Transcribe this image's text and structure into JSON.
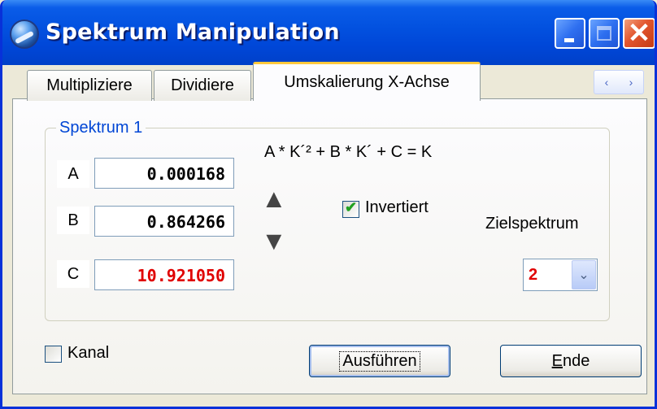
{
  "window": {
    "title": "Spektrum Manipulation",
    "icon": "spectrum-app-icon",
    "controls": {
      "minimize_icon": "minimize-icon",
      "maximize_icon": "maximize-icon",
      "close_symbol": "✕"
    }
  },
  "tabs": [
    {
      "label": "Multipliziere",
      "active": false
    },
    {
      "label": "Dividiere",
      "active": false
    },
    {
      "label": "Umskalierung X-Achse",
      "active": true
    }
  ],
  "tab_scroll": {
    "left": "‹",
    "right": "›"
  },
  "group": {
    "label": "Spektrum 1",
    "params": [
      {
        "label": "A",
        "value": "0.000168"
      },
      {
        "label": "B",
        "value": "0.864266"
      },
      {
        "label": "C",
        "value": "10.921050"
      }
    ]
  },
  "formula": "A * K´² + B * K´ + C = K",
  "arrows": {
    "up": "▲",
    "down": "▼"
  },
  "invertiert": {
    "label": "Invertiert",
    "checked": true
  },
  "zielspektrum": {
    "label": "Zielspektrum",
    "value": "2",
    "dropdown_symbol": "⌄"
  },
  "kanal": {
    "label": "Kanal",
    "checked": false
  },
  "buttons": {
    "ausfuehren": "Ausführen",
    "ende": "Ende"
  },
  "colors": {
    "titlebar": "#0352e0",
    "accent": "#0046d5",
    "red_value": "#e00000",
    "tab_highlight": "#ffc83c"
  }
}
